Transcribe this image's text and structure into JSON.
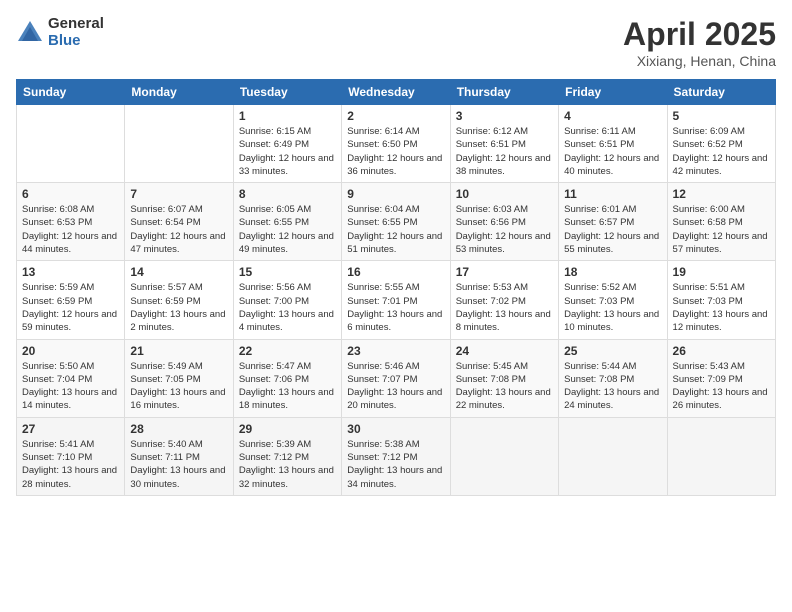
{
  "header": {
    "logo_general": "General",
    "logo_blue": "Blue",
    "title": "April 2025",
    "subtitle": "Xixiang, Henan, China"
  },
  "calendar": {
    "weekdays": [
      "Sunday",
      "Monday",
      "Tuesday",
      "Wednesday",
      "Thursday",
      "Friday",
      "Saturday"
    ],
    "weeks": [
      [
        {
          "day": "",
          "info": ""
        },
        {
          "day": "",
          "info": ""
        },
        {
          "day": "1",
          "info": "Sunrise: 6:15 AM\nSunset: 6:49 PM\nDaylight: 12 hours and 33 minutes."
        },
        {
          "day": "2",
          "info": "Sunrise: 6:14 AM\nSunset: 6:50 PM\nDaylight: 12 hours and 36 minutes."
        },
        {
          "day": "3",
          "info": "Sunrise: 6:12 AM\nSunset: 6:51 PM\nDaylight: 12 hours and 38 minutes."
        },
        {
          "day": "4",
          "info": "Sunrise: 6:11 AM\nSunset: 6:51 PM\nDaylight: 12 hours and 40 minutes."
        },
        {
          "day": "5",
          "info": "Sunrise: 6:09 AM\nSunset: 6:52 PM\nDaylight: 12 hours and 42 minutes."
        }
      ],
      [
        {
          "day": "6",
          "info": "Sunrise: 6:08 AM\nSunset: 6:53 PM\nDaylight: 12 hours and 44 minutes."
        },
        {
          "day": "7",
          "info": "Sunrise: 6:07 AM\nSunset: 6:54 PM\nDaylight: 12 hours and 47 minutes."
        },
        {
          "day": "8",
          "info": "Sunrise: 6:05 AM\nSunset: 6:55 PM\nDaylight: 12 hours and 49 minutes."
        },
        {
          "day": "9",
          "info": "Sunrise: 6:04 AM\nSunset: 6:55 PM\nDaylight: 12 hours and 51 minutes."
        },
        {
          "day": "10",
          "info": "Sunrise: 6:03 AM\nSunset: 6:56 PM\nDaylight: 12 hours and 53 minutes."
        },
        {
          "day": "11",
          "info": "Sunrise: 6:01 AM\nSunset: 6:57 PM\nDaylight: 12 hours and 55 minutes."
        },
        {
          "day": "12",
          "info": "Sunrise: 6:00 AM\nSunset: 6:58 PM\nDaylight: 12 hours and 57 minutes."
        }
      ],
      [
        {
          "day": "13",
          "info": "Sunrise: 5:59 AM\nSunset: 6:59 PM\nDaylight: 12 hours and 59 minutes."
        },
        {
          "day": "14",
          "info": "Sunrise: 5:57 AM\nSunset: 6:59 PM\nDaylight: 13 hours and 2 minutes."
        },
        {
          "day": "15",
          "info": "Sunrise: 5:56 AM\nSunset: 7:00 PM\nDaylight: 13 hours and 4 minutes."
        },
        {
          "day": "16",
          "info": "Sunrise: 5:55 AM\nSunset: 7:01 PM\nDaylight: 13 hours and 6 minutes."
        },
        {
          "day": "17",
          "info": "Sunrise: 5:53 AM\nSunset: 7:02 PM\nDaylight: 13 hours and 8 minutes."
        },
        {
          "day": "18",
          "info": "Sunrise: 5:52 AM\nSunset: 7:03 PM\nDaylight: 13 hours and 10 minutes."
        },
        {
          "day": "19",
          "info": "Sunrise: 5:51 AM\nSunset: 7:03 PM\nDaylight: 13 hours and 12 minutes."
        }
      ],
      [
        {
          "day": "20",
          "info": "Sunrise: 5:50 AM\nSunset: 7:04 PM\nDaylight: 13 hours and 14 minutes."
        },
        {
          "day": "21",
          "info": "Sunrise: 5:49 AM\nSunset: 7:05 PM\nDaylight: 13 hours and 16 minutes."
        },
        {
          "day": "22",
          "info": "Sunrise: 5:47 AM\nSunset: 7:06 PM\nDaylight: 13 hours and 18 minutes."
        },
        {
          "day": "23",
          "info": "Sunrise: 5:46 AM\nSunset: 7:07 PM\nDaylight: 13 hours and 20 minutes."
        },
        {
          "day": "24",
          "info": "Sunrise: 5:45 AM\nSunset: 7:08 PM\nDaylight: 13 hours and 22 minutes."
        },
        {
          "day": "25",
          "info": "Sunrise: 5:44 AM\nSunset: 7:08 PM\nDaylight: 13 hours and 24 minutes."
        },
        {
          "day": "26",
          "info": "Sunrise: 5:43 AM\nSunset: 7:09 PM\nDaylight: 13 hours and 26 minutes."
        }
      ],
      [
        {
          "day": "27",
          "info": "Sunrise: 5:41 AM\nSunset: 7:10 PM\nDaylight: 13 hours and 28 minutes."
        },
        {
          "day": "28",
          "info": "Sunrise: 5:40 AM\nSunset: 7:11 PM\nDaylight: 13 hours and 30 minutes."
        },
        {
          "day": "29",
          "info": "Sunrise: 5:39 AM\nSunset: 7:12 PM\nDaylight: 13 hours and 32 minutes."
        },
        {
          "day": "30",
          "info": "Sunrise: 5:38 AM\nSunset: 7:12 PM\nDaylight: 13 hours and 34 minutes."
        },
        {
          "day": "",
          "info": ""
        },
        {
          "day": "",
          "info": ""
        },
        {
          "day": "",
          "info": ""
        }
      ]
    ]
  }
}
